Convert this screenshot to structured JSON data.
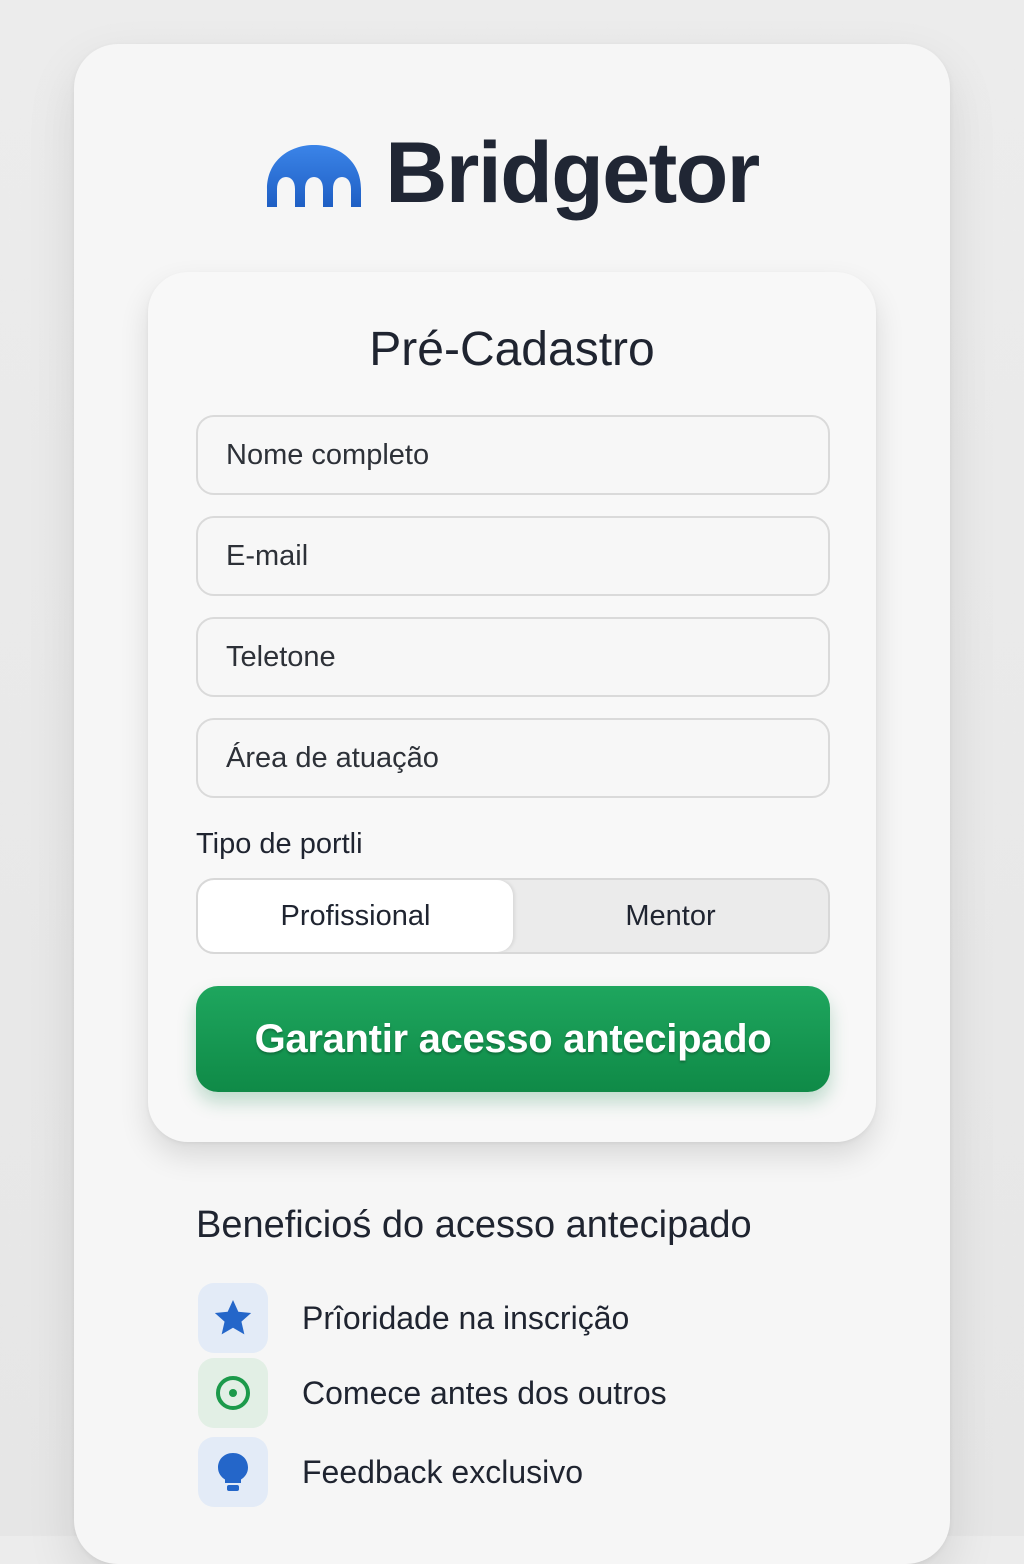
{
  "brand": {
    "name": "Bridgetor",
    "logo_color": "#2a6fd6"
  },
  "form": {
    "title": "Pré-Cadastro",
    "fields": [
      {
        "placeholder": "Nome completo"
      },
      {
        "placeholder": "E-mail"
      },
      {
        "placeholder": "Teletone"
      },
      {
        "placeholder": "Área de atuação"
      }
    ],
    "profile_type_label": "Tipo de portli",
    "profile_options": [
      "Profissional",
      "Mentor"
    ],
    "selected_profile": "Profissional",
    "submit_label": "Garantir acesso antecipado",
    "submit_color": "#149a52"
  },
  "benefits": {
    "title": "Beneficioś do acesso antecipado",
    "items": [
      {
        "icon": "star-icon",
        "label": "Prîoridade na inscrição"
      },
      {
        "icon": "target-icon",
        "label": "Comece antes dos outros"
      },
      {
        "icon": "lightbulb-icon",
        "label": "Feedback exclusivo"
      }
    ]
  }
}
